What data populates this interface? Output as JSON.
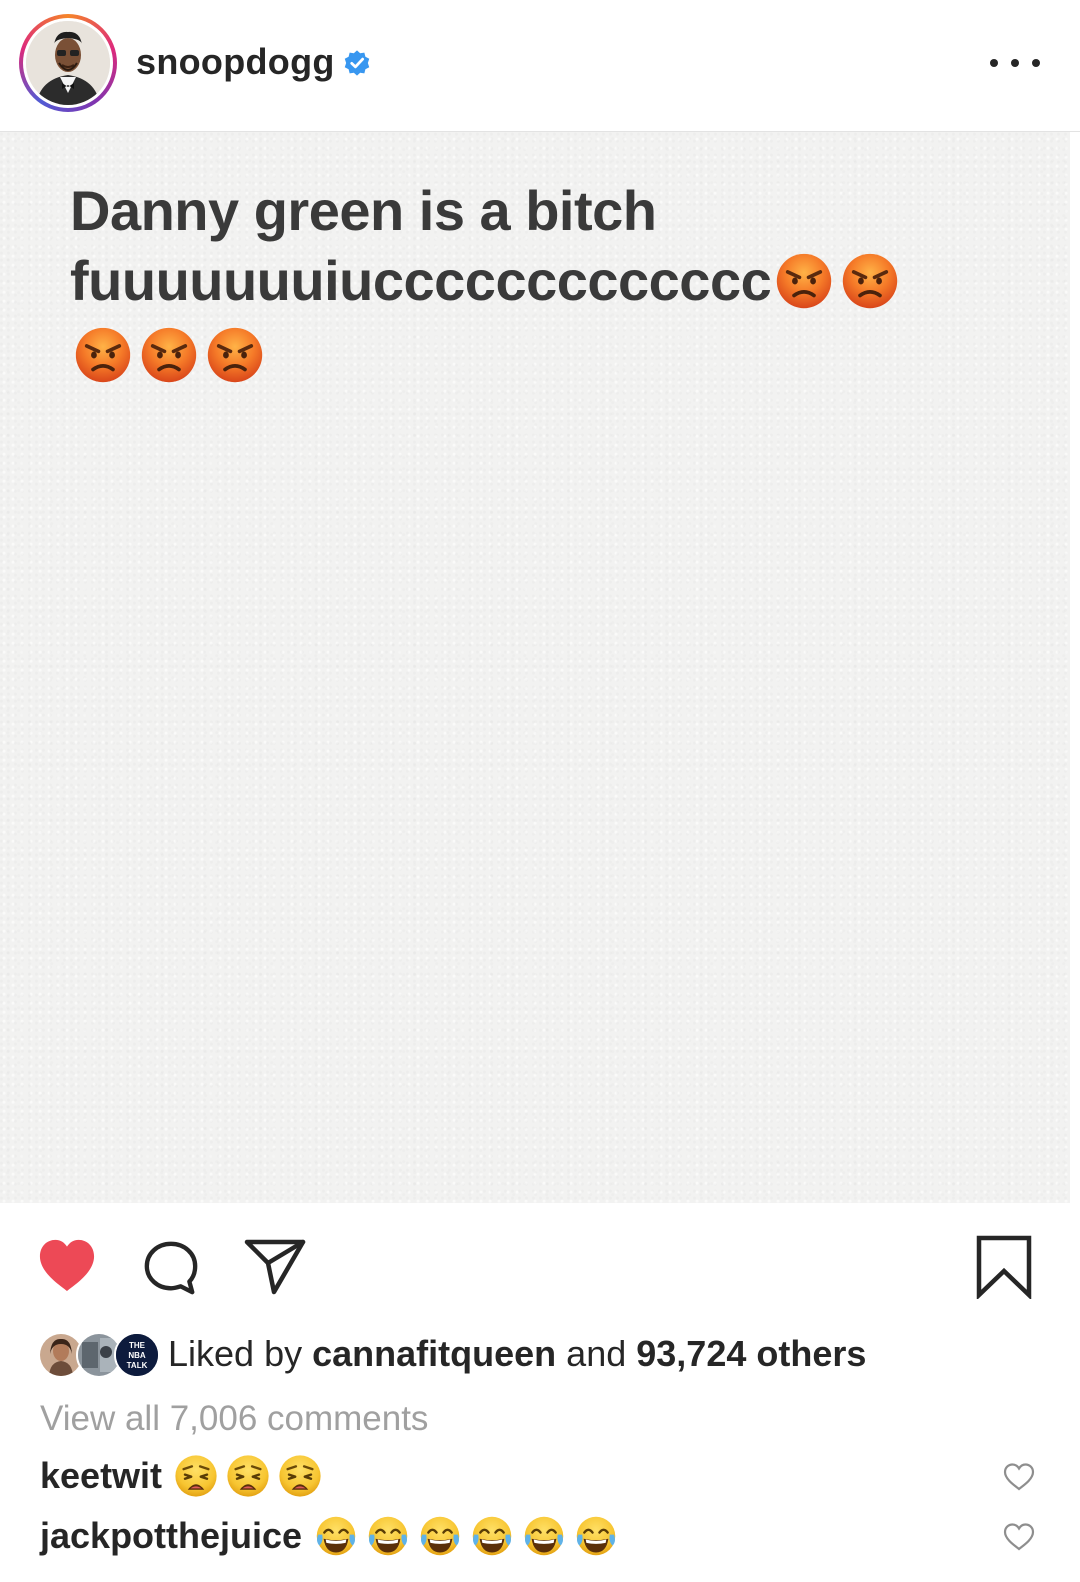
{
  "post": {
    "username": "snoopdogg",
    "verified": true,
    "menu_icon": "more-horizontal-icon",
    "image_text": {
      "line1": "Danny green is a bitch",
      "line2": "fuuuuuuuiuccccccccccccc"
    },
    "angry_emoji_count": 5
  },
  "actions": {
    "liked": true,
    "like_icon": "heart-filled-icon",
    "comment_icon": "comment-bubble-icon",
    "share_icon": "paper-plane-icon",
    "save_icon": "bookmark-icon",
    "like_color": "#ed4956"
  },
  "likes": {
    "prefix": "Liked by",
    "user": "cannafitqueen",
    "conj": "and",
    "count_text": "93,724 others",
    "avatar_badge_text": "THE NBA TALK"
  },
  "comments": {
    "view_all": "View all 7,006 comments",
    "items": [
      {
        "user": "keetwit",
        "emoji": "weary",
        "emoji_count": 3
      },
      {
        "user": "jackpotthejuice",
        "emoji": "tears-of-joy",
        "emoji_count": 6
      }
    ]
  },
  "colors": {
    "text": "#262626",
    "muted": "#a0a0a0",
    "verified": "#3897f0",
    "image_background": "#f2f2f1"
  }
}
